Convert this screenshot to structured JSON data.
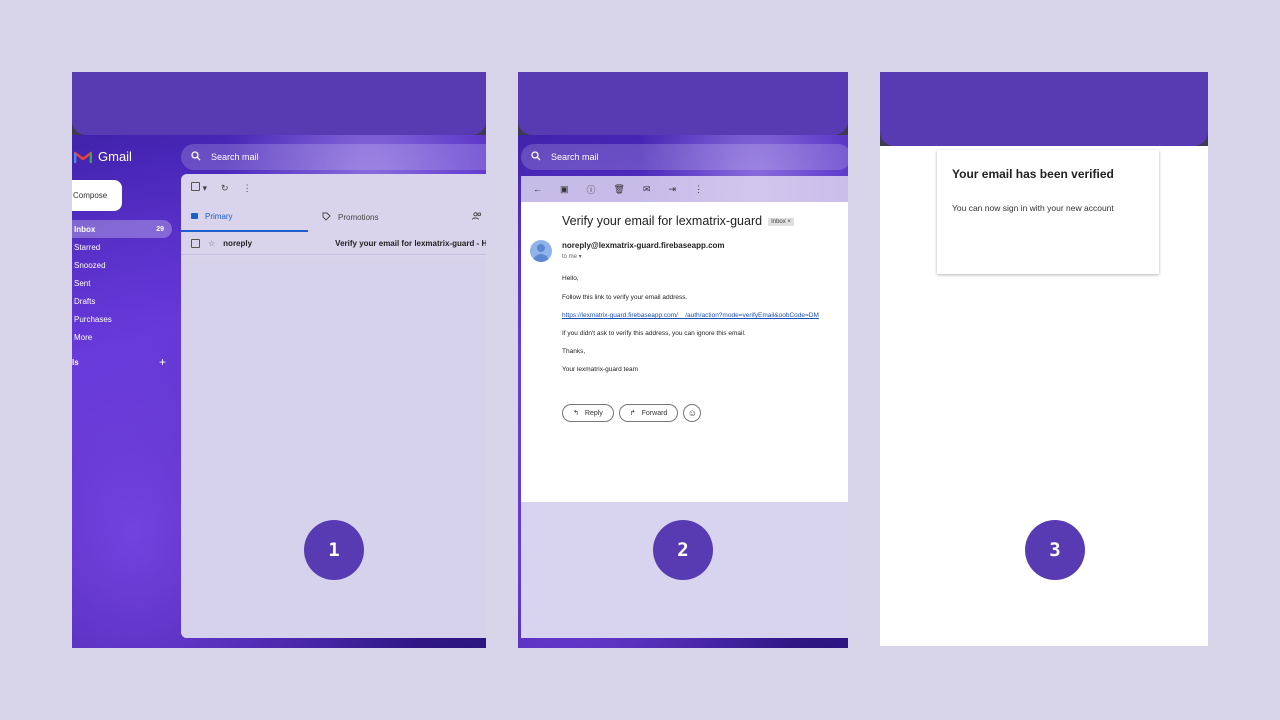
{
  "colors": {
    "page_bg": "#d8d4ea",
    "accent_purple": "#583bb2",
    "link_blue": "#1a4fb8"
  },
  "panel1": {
    "app_name": "Gmail",
    "search_placeholder": "Search mail",
    "compose_label": "Compose",
    "nav": [
      {
        "label": "Inbox",
        "count": "29",
        "active": true
      },
      {
        "label": "Starred"
      },
      {
        "label": "Snoozed"
      },
      {
        "label": "Sent"
      },
      {
        "label": "Drafts"
      },
      {
        "label": "Purchases"
      },
      {
        "label": "More"
      }
    ],
    "labels_heading": "ls",
    "labels_add": "+",
    "tabs": {
      "primary": "Primary",
      "promotions": "Promotions"
    },
    "rows": [
      {
        "from": "noreply",
        "subject": "Verify your email for lexmatrix-guard - H"
      }
    ]
  },
  "panel2": {
    "search_placeholder": "Search mail",
    "subject": "Verify your email for lexmatrix-guard",
    "inbox_chip": "Inbox ×",
    "sender": "noreply@lexmatrix-guard.firebaseapp.com",
    "to": "to me ▾",
    "lines": {
      "greeting": "Hello,",
      "instruction": "Follow this link to verify your email address.",
      "link": "https://lexmatrix-guard.firebaseapp.com/__/auth/action?mode=verifyEmail&oobCode=DM",
      "ignore": "If you didn't ask to verify this address, you can ignore this email.",
      "thanks": "Thanks,",
      "team": "Your lexmatrix-guard team"
    },
    "reply_label": "Reply",
    "forward_label": "Forward"
  },
  "panel3": {
    "title": "Your email has been verified",
    "message": "You can now sign in with your new account"
  },
  "steps": [
    "1",
    "2",
    "3"
  ]
}
